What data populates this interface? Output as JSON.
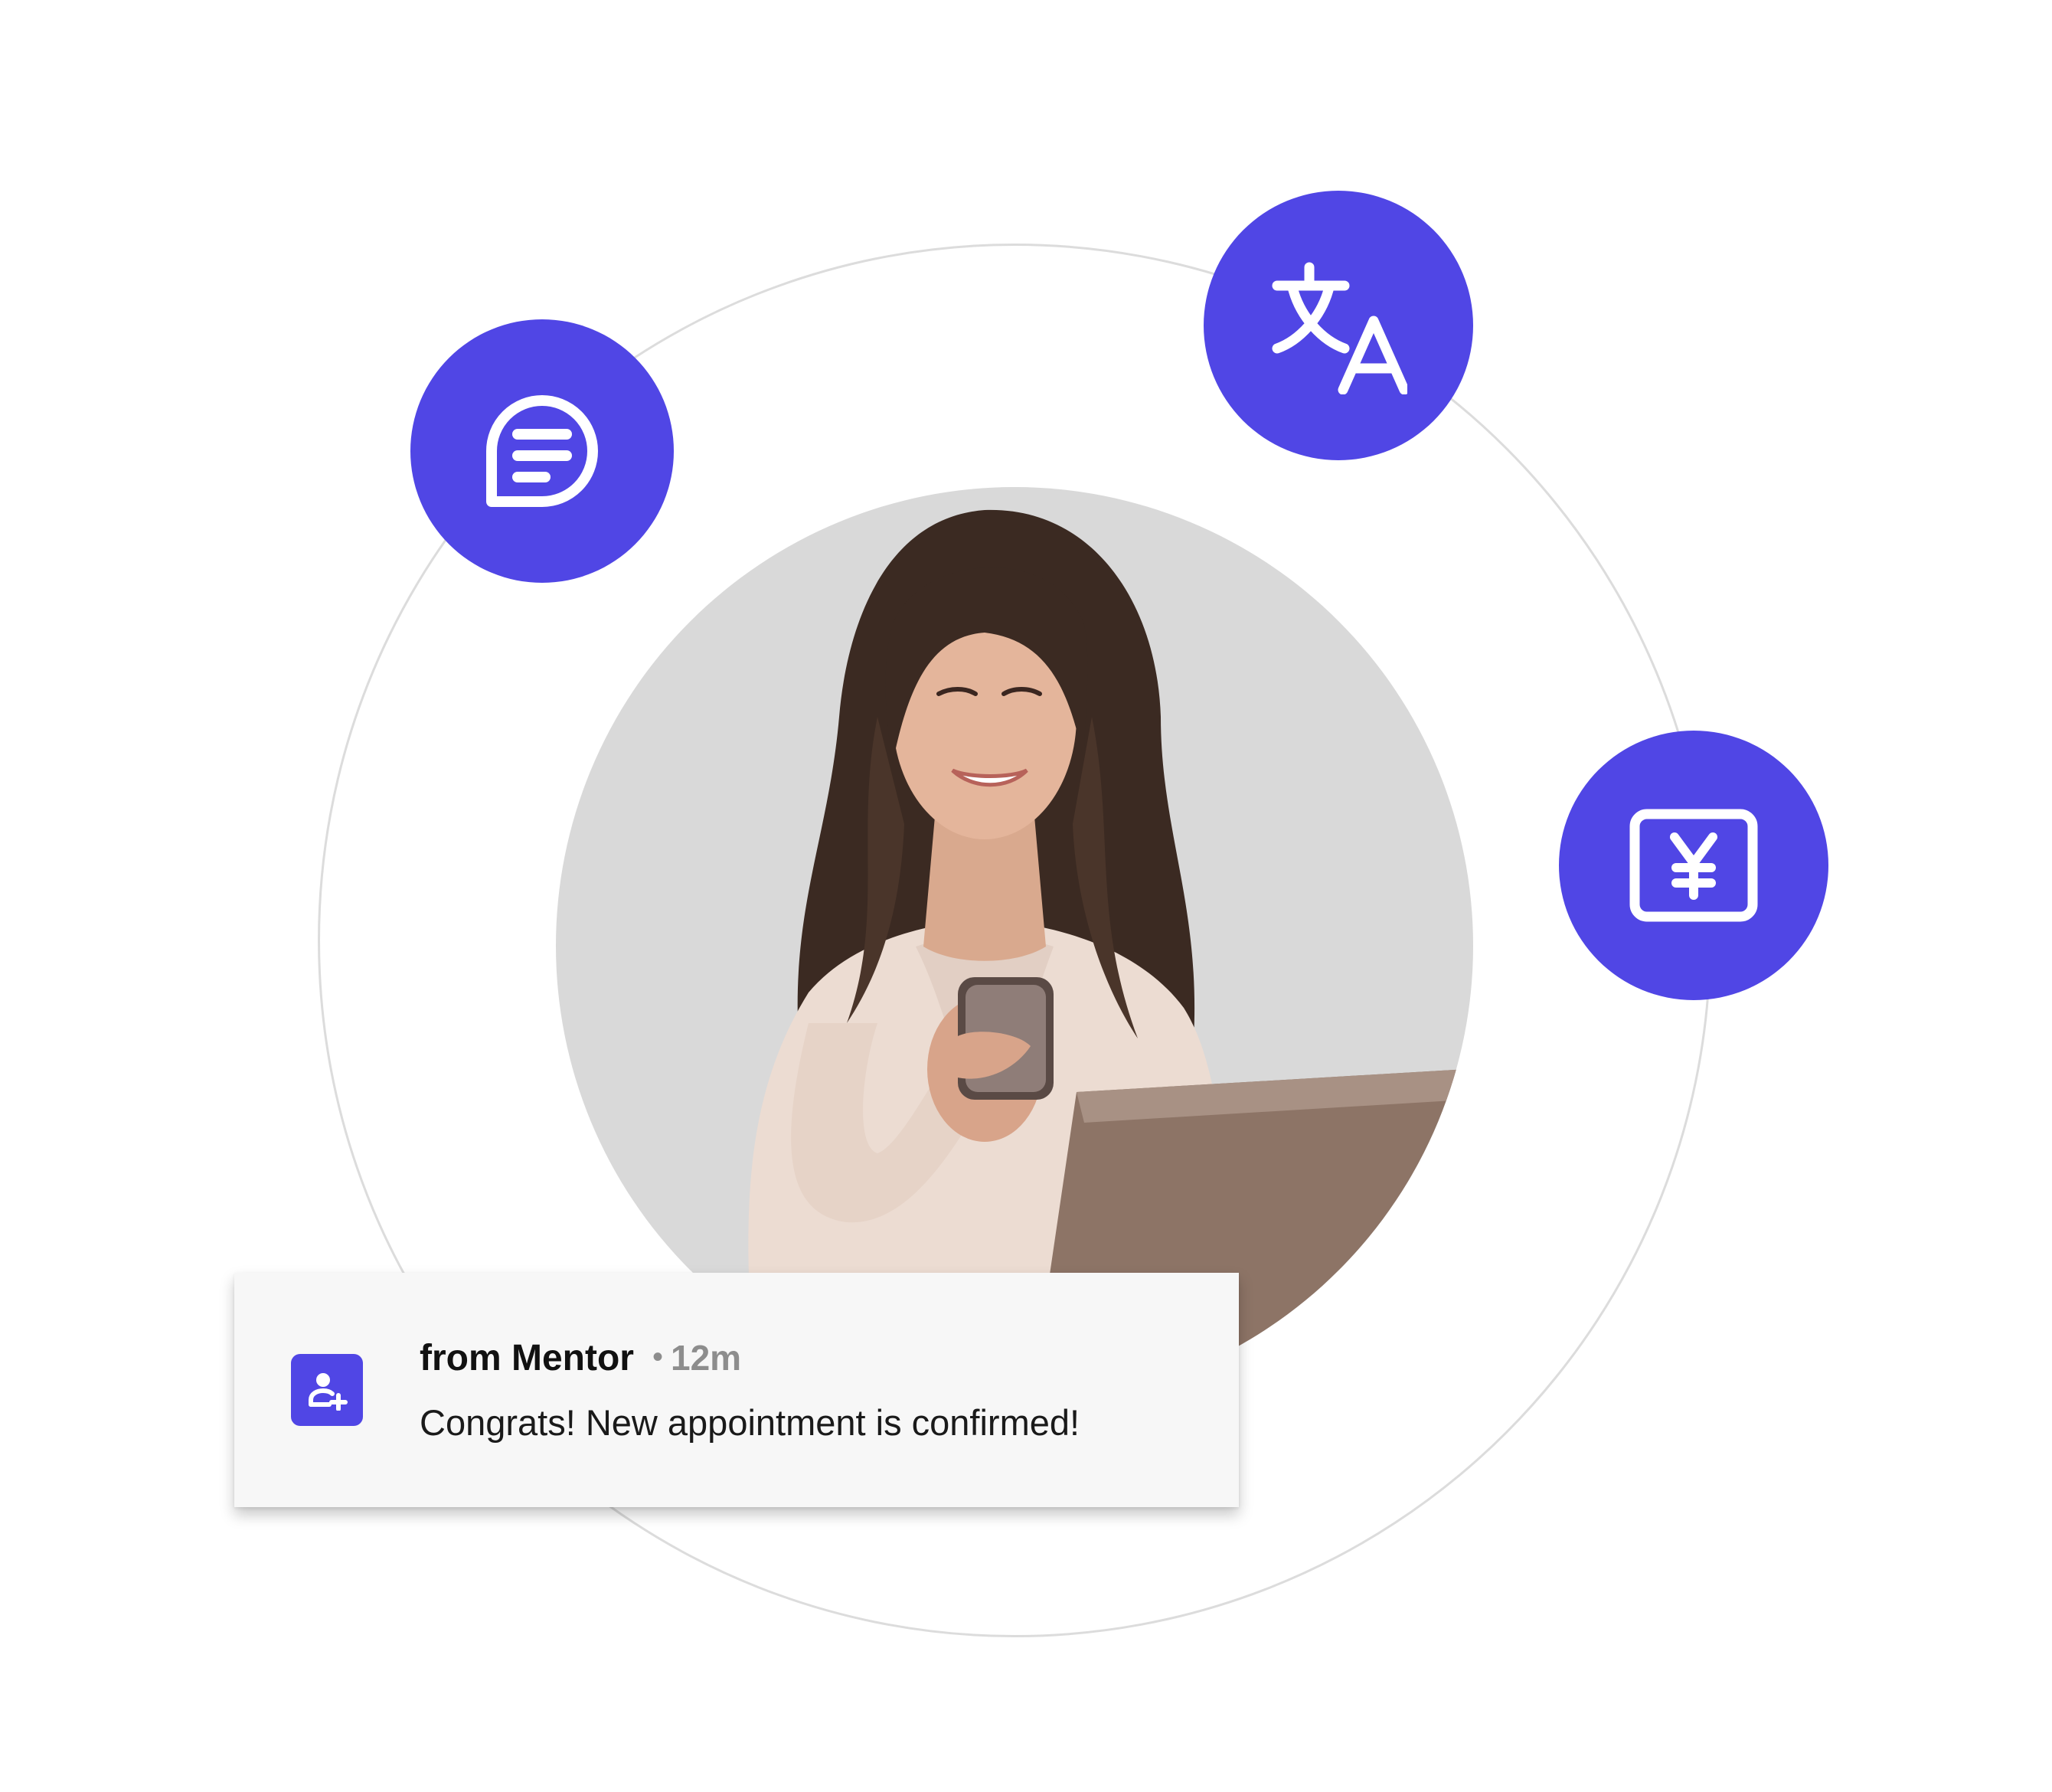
{
  "colors": {
    "accent": "#5046e5",
    "orbit": "#dcdcdc",
    "photo_background": "#d9d9d9",
    "notification_background": "#f7f7f7"
  },
  "features": [
    {
      "name": "chat",
      "icon": "chat-bubble-icon"
    },
    {
      "name": "translate",
      "icon": "translate-icon"
    },
    {
      "name": "currency",
      "icon": "yen-bill-icon"
    }
  ],
  "photo": {
    "subject": "woman-with-phone-and-laptop"
  },
  "notification": {
    "icon": "add-user-icon",
    "sender": "from Mentor",
    "separator": "•",
    "time": "12m",
    "message": "Congrats! New appointment is confirmed!"
  }
}
